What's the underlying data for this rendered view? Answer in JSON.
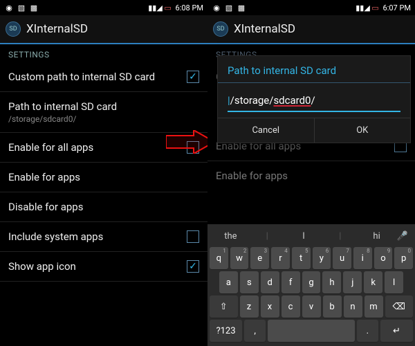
{
  "left": {
    "status_time": "6:08 PM",
    "app_title": "XInternalSD",
    "section": "SETTINGS",
    "rows": {
      "custom_path": {
        "title": "Custom path to internal SD card",
        "checked": true
      },
      "path": {
        "title": "Path to internal SD card",
        "sub": "/storage/sdcard0/"
      },
      "enable_all": {
        "title": "Enable for all apps",
        "checked": false
      },
      "enable_for": {
        "title": "Enable for apps"
      },
      "disable_for": {
        "title": "Disable for apps"
      },
      "include_sys": {
        "title": "Include system apps",
        "checked": false
      },
      "show_icon": {
        "title": "Show app icon",
        "checked": true
      }
    }
  },
  "right": {
    "status_time": "6:07 PM",
    "app_title": "XInternalSD",
    "section": "SETTINGS",
    "dim_rows": {
      "custom_ghost": "Cu",
      "enable_all": "Enable for all apps",
      "enable_for": "Enable for apps"
    },
    "dialog": {
      "title": "Path to internal SD card",
      "value_prefix": "/storage/",
      "value_mid": "sdcard0",
      "value_suffix": "/",
      "cancel": "Cancel",
      "ok": "OK"
    },
    "suggestions": {
      "a": "the",
      "b": "I",
      "c": "hi"
    },
    "keys": {
      "r1": [
        "q",
        "w",
        "e",
        "r",
        "t",
        "y",
        "u",
        "i",
        "o",
        "p"
      ],
      "r1sup": [
        "1",
        "2",
        "3",
        "4",
        "5",
        "6",
        "7",
        "8",
        "9",
        "0"
      ],
      "r2": [
        "a",
        "s",
        "d",
        "f",
        "g",
        "h",
        "j",
        "k",
        "l"
      ],
      "shift": "⇧",
      "r3": [
        "z",
        "x",
        "c",
        "v",
        "b",
        "n",
        "m"
      ],
      "back": "⌫",
      "sym": "?123",
      "comma": ",",
      "space": " ",
      "period": ".",
      "enter": "↵"
    }
  }
}
